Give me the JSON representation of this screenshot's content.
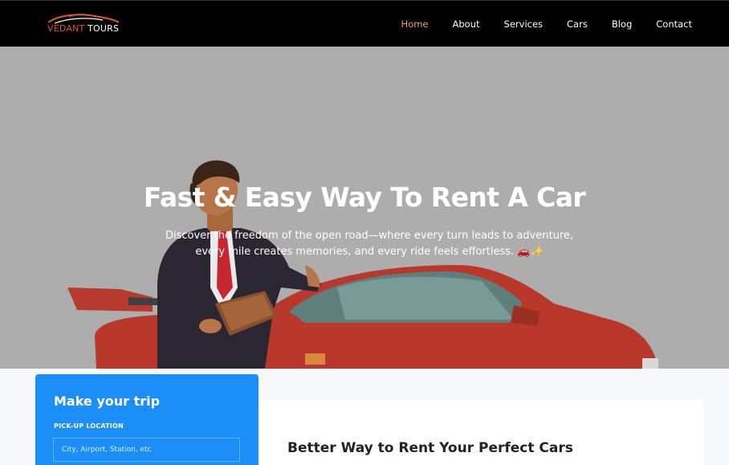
{
  "brand": {
    "name_part1": "VEDANT",
    "name_part2": "TOURS",
    "logo_icon": "car-silhouette-icon",
    "accent": "#e2542b"
  },
  "nav": {
    "items": [
      {
        "label": "Home",
        "active": true
      },
      {
        "label": "About",
        "active": false
      },
      {
        "label": "Services",
        "active": false
      },
      {
        "label": "Cars",
        "active": false
      },
      {
        "label": "Blog",
        "active": false
      },
      {
        "label": "Contact",
        "active": false
      }
    ],
    "active_color": "#f2a25b"
  },
  "hero": {
    "title": "Fast & Easy Way To Rent A Car",
    "subtitle": "Discover the freedom of the open road—where every turn leads to adventure, every mile creates memories, and every ride feels effortless. 🚗✨",
    "background": "#adadad",
    "illustration": "businessman-with-red-sports-car"
  },
  "trip_form": {
    "title": "Make your trip",
    "pickup_label": "PICK-UP LOCATION",
    "pickup_placeholder": "City, Airport, Station, etc",
    "pickup_value": "",
    "background": "#1b8ef8"
  },
  "section": {
    "title": "Better Way to Rent Your Perfect Cars"
  }
}
